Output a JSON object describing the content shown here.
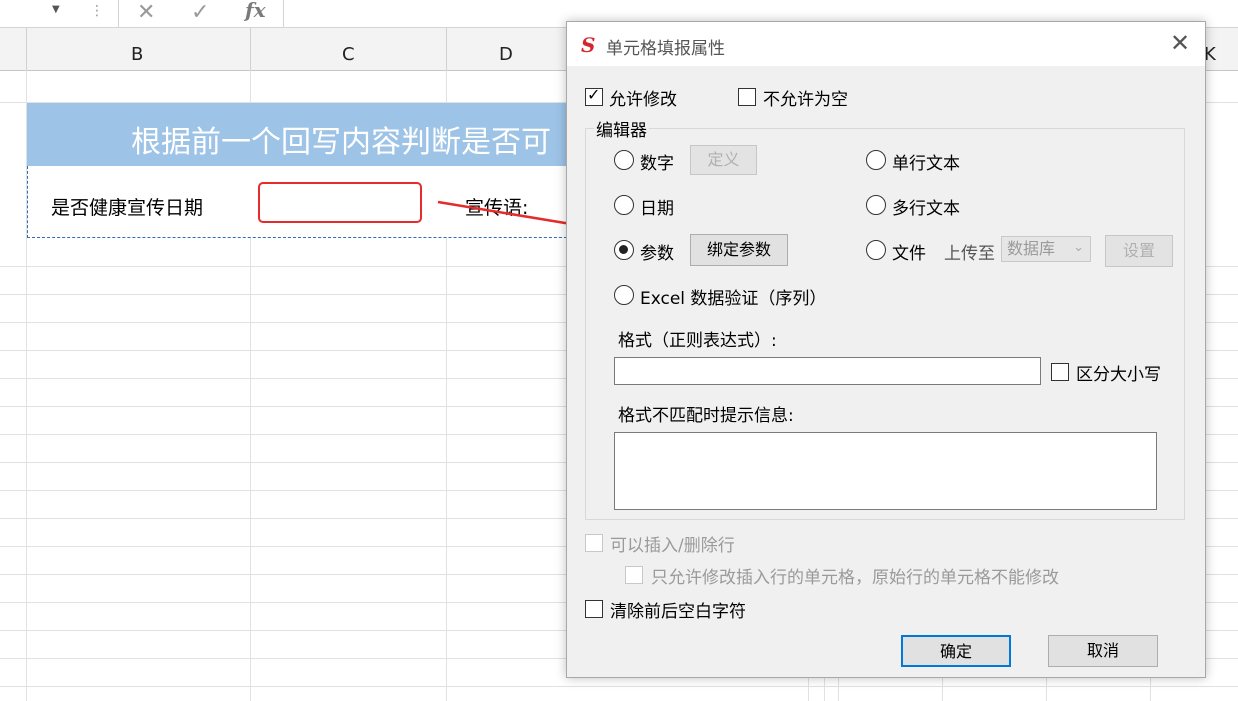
{
  "sheet": {
    "columns": [
      "B",
      "C",
      "D",
      "K"
    ],
    "banner_text": "根据前一个回写内容判断是否可",
    "row_label": "是否健康宣传日期",
    "slogan_label": "宣传语:"
  },
  "dialog": {
    "title": "单元格填报属性",
    "allow_modify": {
      "label": "允许修改",
      "checked": true
    },
    "not_allow_empty": {
      "label": "不允许为空",
      "checked": false
    },
    "editor_group_title": "编辑器",
    "editors": {
      "number": "数字",
      "define_button": "定义",
      "single_line_text": "单行文本",
      "date": "日期",
      "multi_line_text": "多行文本",
      "parameter": "参数",
      "bind_param_button": "绑定参数",
      "file": "文件",
      "upload_to": "上传至",
      "upload_target": "数据库",
      "settings_button": "设置",
      "excel_validation": "Excel 数据验证（序列）"
    },
    "selected_editor": "参数",
    "format_label": "格式（正则表达式）:",
    "format_value": "",
    "case_sensitive_label": "区分大小写",
    "mismatch_label": "格式不匹配时提示信息:",
    "mismatch_value": "",
    "insert_delete_label": "可以插入/删除行",
    "only_inserted_label": "只允许修改插入行的单元格，原始行的单元格不能修改",
    "trim_label": "清除前后空白字符",
    "ok_button": "确定",
    "cancel_button": "取消"
  },
  "colors": {
    "banner": "#9dc3e6",
    "highlight": "#e52b2b",
    "logo": "#d4262c"
  }
}
